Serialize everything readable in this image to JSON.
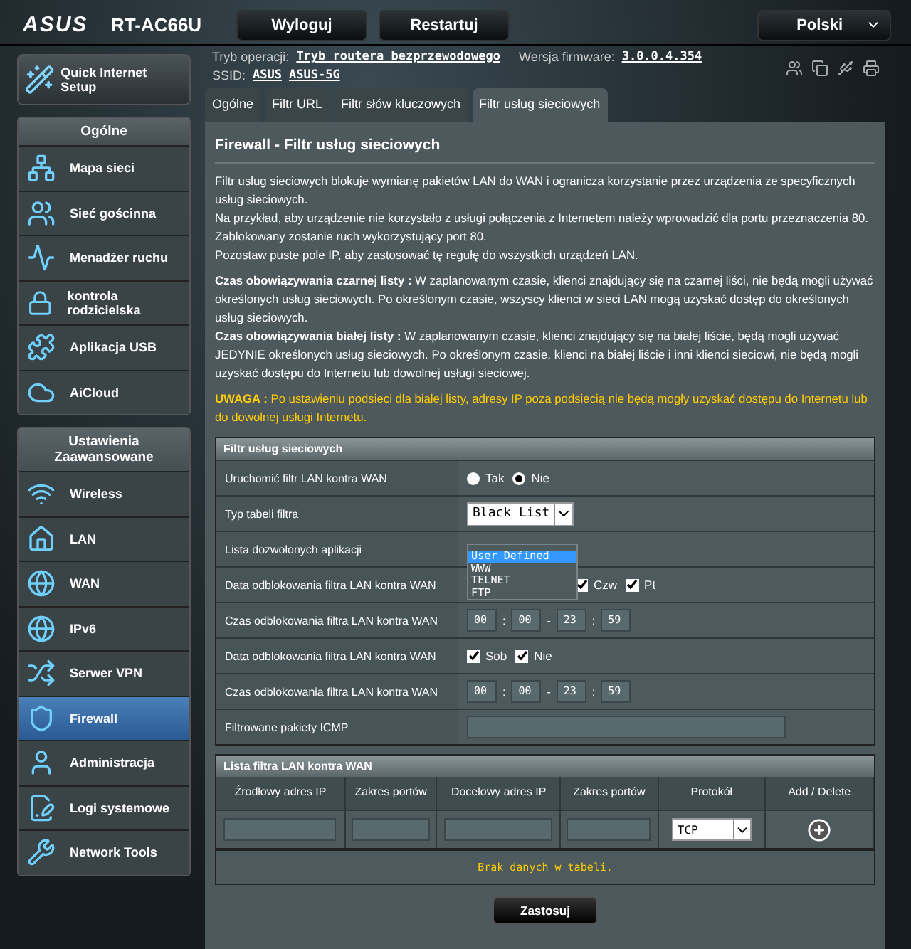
{
  "header": {
    "logo": "ASUS",
    "model": "RT-AC66U",
    "buttons": [
      "Wyloguj",
      "Restartuj"
    ],
    "language": "Polski"
  },
  "info": {
    "op_mode_label": "Tryb operacji:",
    "op_mode": "Tryb routera bezprzewodowego",
    "firmware_label": "Wersja firmware:",
    "firmware": "3.0.0.4.354",
    "ssid_label": "SSID:",
    "ssids": [
      "ASUS",
      "ASUS-5G"
    ]
  },
  "sidebar": {
    "quick_setup": "Quick Internet Setup",
    "sections": [
      {
        "title": "Ogólne",
        "items": [
          {
            "label": "Mapa sieci",
            "selected": false
          },
          {
            "label": "Sieć gościnna",
            "selected": false
          },
          {
            "label": "Menadżer ruchu",
            "selected": false
          },
          {
            "label": "kontrola rodzicielska",
            "selected": false
          },
          {
            "label": "Aplikacja USB",
            "selected": false
          },
          {
            "label": "AiCloud",
            "selected": false
          }
        ]
      },
      {
        "title": "Ustawienia Zaawansowane",
        "items": [
          {
            "label": "Wireless",
            "selected": false
          },
          {
            "label": "LAN",
            "selected": false
          },
          {
            "label": "WAN",
            "selected": false
          },
          {
            "label": "IPv6",
            "selected": false
          },
          {
            "label": "Serwer VPN",
            "selected": false
          },
          {
            "label": "Firewall",
            "selected": true
          },
          {
            "label": "Administracja",
            "selected": false
          },
          {
            "label": "Logi systemowe",
            "selected": false
          },
          {
            "label": "Network Tools",
            "selected": false
          }
        ]
      }
    ]
  },
  "tabs": [
    {
      "label": "Ogólne",
      "selected": false
    },
    {
      "label": "Filtr URL",
      "selected": false
    },
    {
      "label": "Filtr słów kluczowych",
      "selected": false
    },
    {
      "label": "Filtr usług sieciowych",
      "selected": true
    }
  ],
  "content": {
    "title": "Firewall - Filtr usług sieciowych",
    "paragraphs": [
      "Filtr usług sieciowych blokuje wymianę pakietów LAN do WAN i ogranicza korzystanie przez urządzenia ze specyficznych usług sieciowych.\nNa przykład, aby urządzenie nie korzystało z usługi połączenia z Internetem należy wprowadzić dla portu przeznaczenia 80.\nZablokowany zostanie ruch wykorzystujący port 80.\nPozostaw puste pole IP, aby zastosować tę regułę do wszystkich urządzeń LAN.",
      "**Czas obowiązywania czarnej listy :** W zaplanowanym czasie, klienci znajdujący się na czarnej liści, nie będą mogli używać określonych usług sieciowych. Po określonym czasie, wszyscy klienci w sieci LAN mogą uzyskać dostęp do określonych usług sieciowych.\n**Czas obowiązywania białej listy :** W zaplanowanym czasie, klienci znajdujący się na białej liście, będą mogli używać JEDYNIE określonych usług sieciowych. Po określonym czasie, klienci na białej liście i inni klienci sieciowi, nie będą mogli uzyskać dostępu do Internetu lub dowolnej usługi sieciowej."
    ],
    "warning": "**UWAGA :** Po ustawieniu podsieci dla białej listy, adresy IP poza podsiecią nie będą mogły uzyskać dostępu do Internetu lub do dowolnej usługi Internetu.",
    "form": {
      "title": "Filtr usług sieciowych",
      "rows": [
        {
          "label": "Uruchomić filtr LAN kontra WAN",
          "kind": "radio",
          "options": [
            {
              "label": "Tak",
              "selected": false
            },
            {
              "label": "Nie",
              "selected": true
            }
          ]
        },
        {
          "label": "Typ tabeli filtra",
          "kind": "select",
          "value": "Black List"
        },
        {
          "label": "Lista dozwolonych aplikacji",
          "kind": "listbox",
          "options": [
            {
              "label": "User Defined",
              "selected": true
            },
            {
              "label": "WWW",
              "selected": false
            },
            {
              "label": "TELNET",
              "selected": false
            },
            {
              "label": "FTP",
              "selected": false
            }
          ]
        },
        {
          "label": "Data odblokowania filtra LAN kontra WAN",
          "kind": "days",
          "days": [
            {
              "label": "Czw",
              "checked": true
            },
            {
              "label": "Pt",
              "checked": true
            }
          ]
        },
        {
          "label": "Czas odblokowania filtra LAN kontra WAN",
          "kind": "time",
          "values": [
            "00",
            "00",
            "23",
            "59"
          ],
          "separators": [
            ":",
            "-",
            ":"
          ]
        },
        {
          "label": "Data odblokowania filtra LAN kontra WAN",
          "kind": "days",
          "days": [
            {
              "label": "Sob",
              "checked": true
            },
            {
              "label": "Nie",
              "checked": true
            }
          ]
        },
        {
          "label": "Czas odblokowania filtra LAN kontra WAN",
          "kind": "time",
          "values": [
            "00",
            "00",
            "23",
            "59"
          ],
          "separators": [
            ":",
            "-",
            ":"
          ]
        },
        {
          "label": "Filtrowane pakiety ICMP",
          "kind": "text"
        }
      ]
    },
    "table": {
      "title": "Lista filtra LAN kontra WAN",
      "columns": [
        "Źrodłowy adres IP",
        "Zakres portów",
        "Docelowy adres IP",
        "Zakres portów",
        "Protokół",
        "Add / Delete"
      ],
      "protocol": "TCP",
      "empty": "Brak danych w tabeli."
    },
    "apply": "Zastosuj"
  }
}
